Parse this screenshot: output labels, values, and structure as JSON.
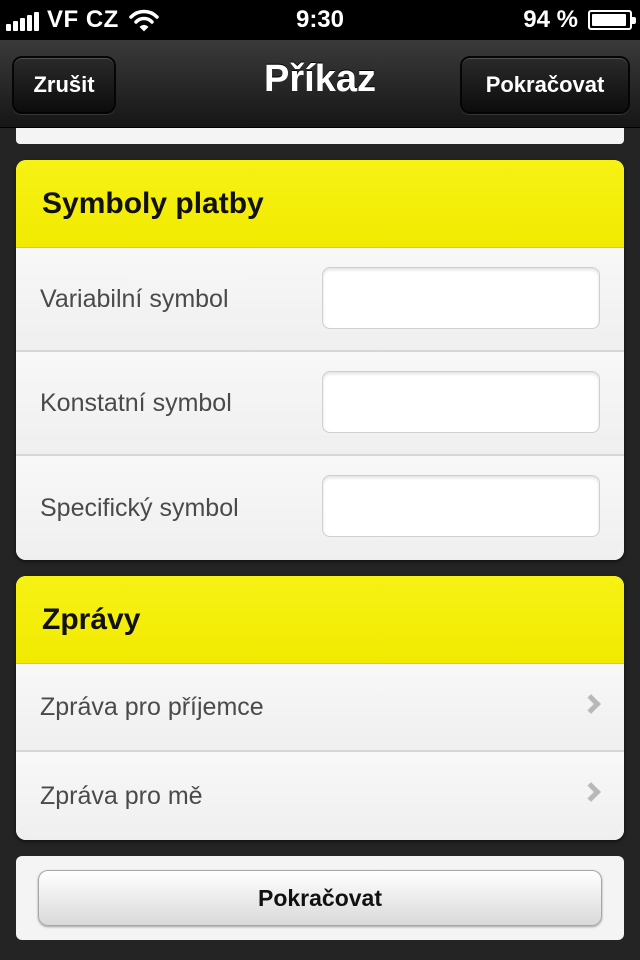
{
  "status_bar": {
    "carrier": "VF CZ",
    "time": "9:30",
    "battery": "94 %",
    "battery_level": 0.94
  },
  "nav": {
    "title": "Příkaz",
    "cancel_label": "Zrušit",
    "continue_label": "Pokračovat"
  },
  "payment_symbols": {
    "title": "Symboly platby",
    "fields": [
      {
        "label": "Variabilní symbol",
        "value": ""
      },
      {
        "label": "Konstatní symbol",
        "value": ""
      },
      {
        "label": "Specifický symbol",
        "value": ""
      }
    ]
  },
  "messages": {
    "title": "Zprávy",
    "items": [
      {
        "label": "Zpráva pro příjemce"
      },
      {
        "label": "Zpráva pro mě"
      }
    ]
  },
  "footer": {
    "continue_label": "Pokračovat"
  }
}
